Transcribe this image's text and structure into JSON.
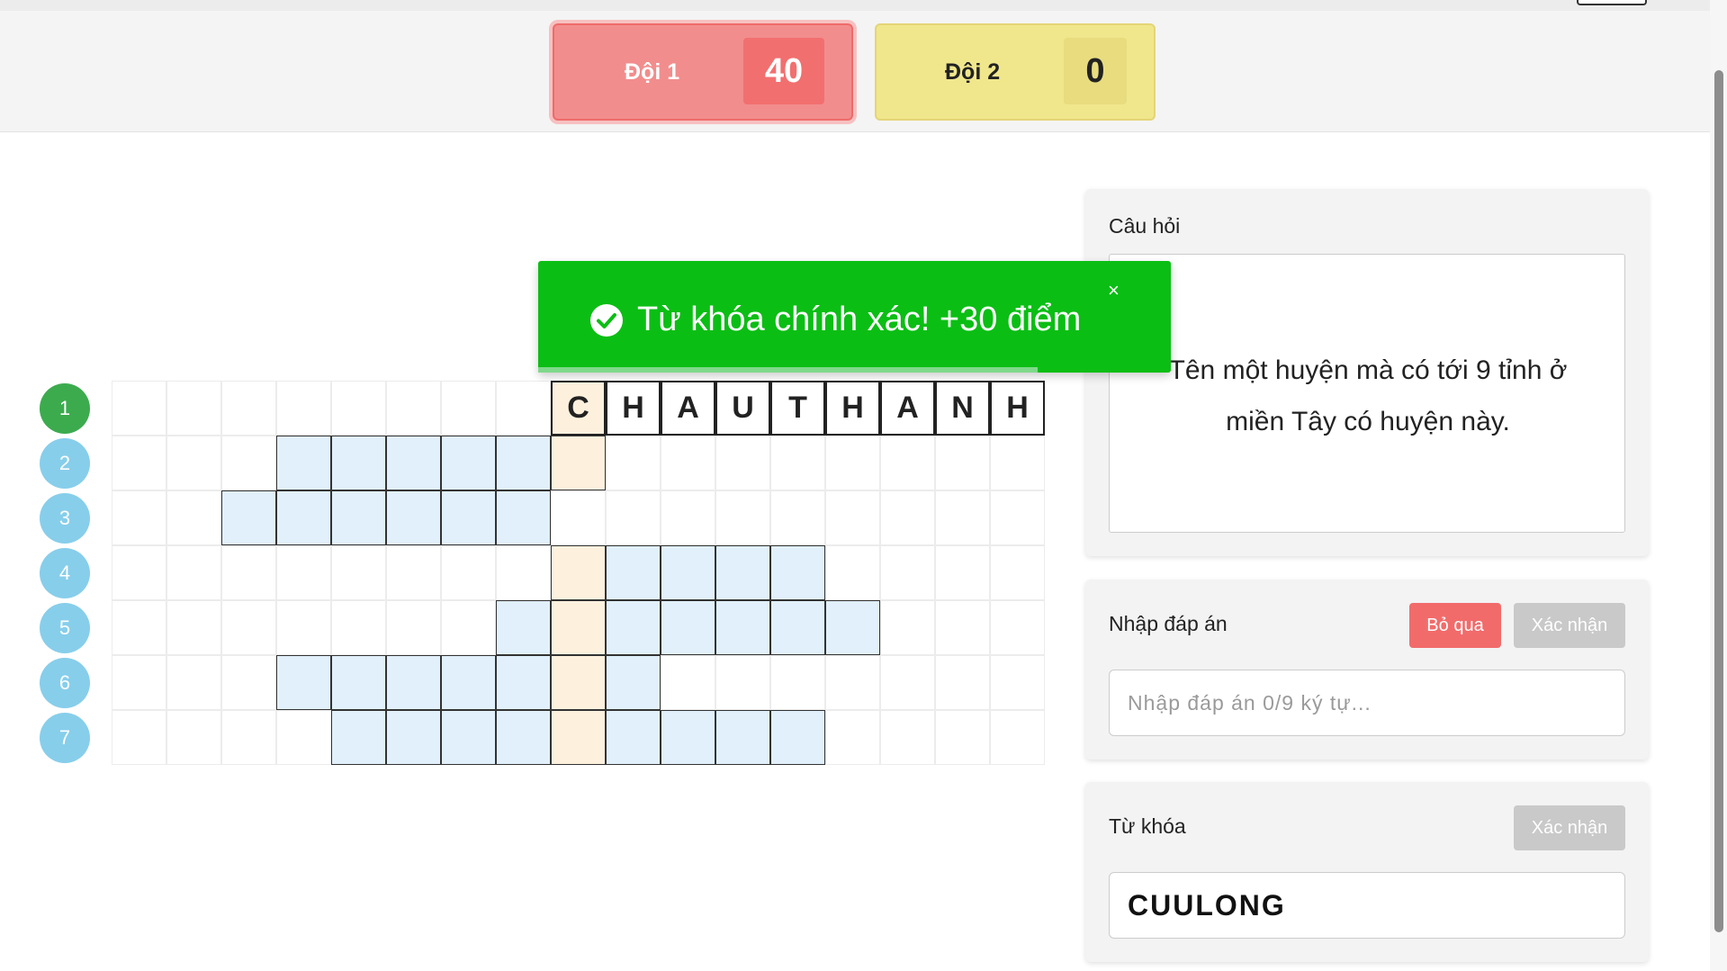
{
  "teams": [
    {
      "name": "Đội 1",
      "score": "40"
    },
    {
      "name": "Đội 2",
      "score": "0"
    }
  ],
  "rows": [
    "1",
    "2",
    "3",
    "4",
    "5",
    "6",
    "7"
  ],
  "answer_row1": [
    "C",
    "H",
    "A",
    "U",
    "T",
    "H",
    "A",
    "N",
    "H"
  ],
  "question": {
    "label": "Câu hỏi",
    "text": "Tên một huyện mà có tới 9 tỉnh ở miền Tây có huyện này."
  },
  "answer": {
    "label": "Nhập đáp án",
    "skip": "Bỏ qua",
    "confirm": "Xác nhận",
    "placeholder": "Nhập đáp án 0/9 ký tự..."
  },
  "keyword": {
    "label": "Từ khóa",
    "confirm": "Xác nhận",
    "value": "CUULONG"
  },
  "toast": {
    "message": "Từ khóa chính xác! +30 điểm",
    "close": "×",
    "progress": 0.79
  },
  "colors": {
    "team1": "#f28d8d",
    "team2": "#f0e68c",
    "toast": "#0bbe14",
    "row_active": "#3cab4e",
    "row_default": "#87ceeb",
    "cell": "#e1f0fb",
    "key_cell": "#fdf1de"
  }
}
